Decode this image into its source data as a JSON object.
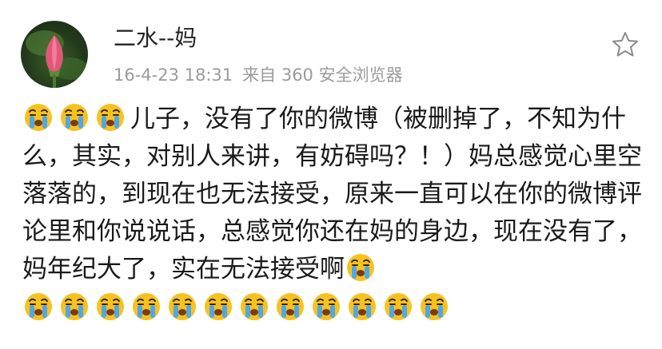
{
  "post": {
    "username": "二水--妈",
    "timestamp": "16-4-23 18:31",
    "source": "来自 360 安全浏览器",
    "text": "儿子，没有了你的微博（被删掉了，不知为什么，其实，对别人来讲，有妨碍吗？！）妈总感觉心里空落落的，到现在也无法接受，原来一直可以在你的微博评论里和你说说话，总感觉你还在妈的身边，现在没有了，妈年纪大了，实在无法接受啊",
    "leading_emoji_count": 3,
    "trailing_emoji_count": 12,
    "emoji_name": "crying-face-emoji"
  },
  "icons": {
    "favorite": "star-outline-icon",
    "avatar": "pink-lotus-bud-image"
  },
  "colors": {
    "meta_text": "#9b9b9b",
    "emoji_face": "#f7c21f",
    "emoji_tears": "#4fa7e8"
  }
}
